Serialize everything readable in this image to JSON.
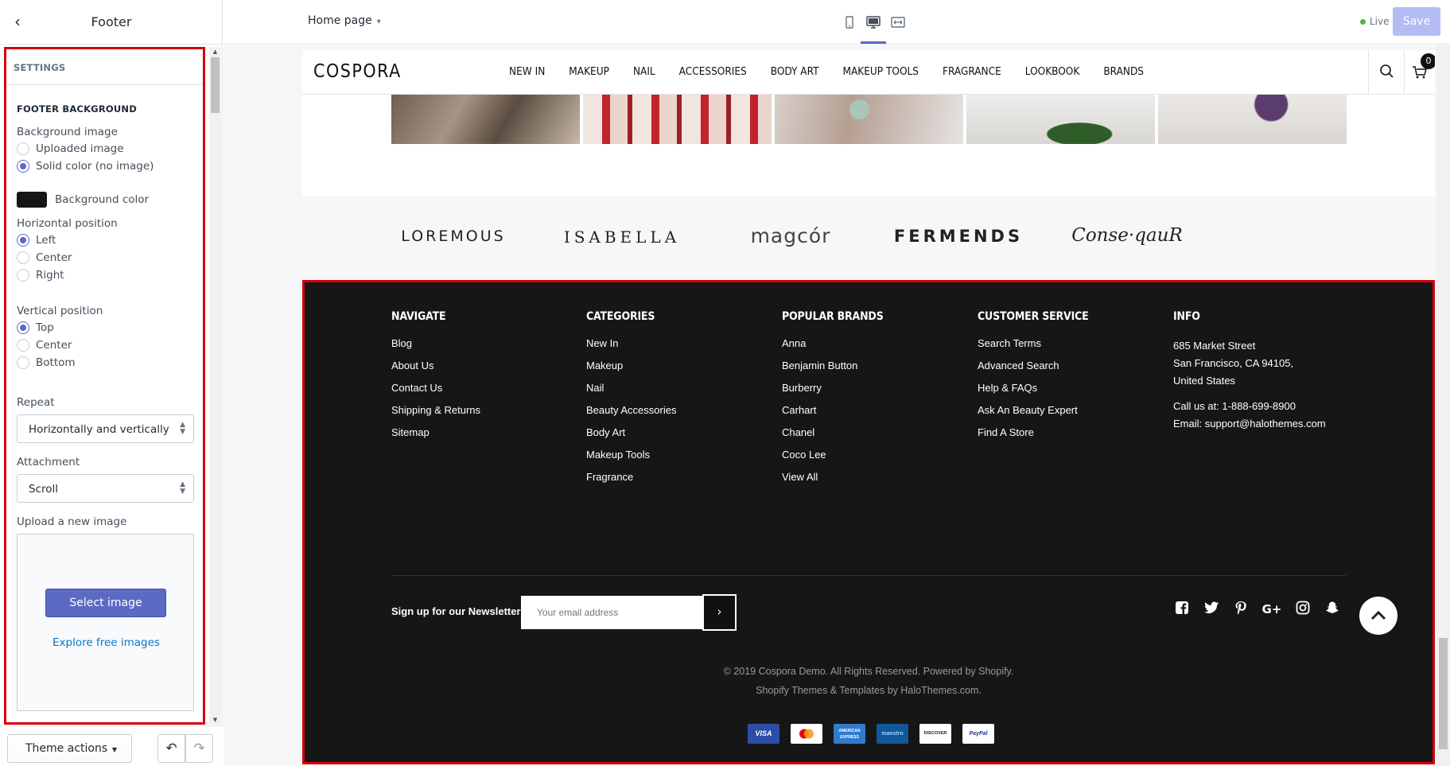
{
  "sidebar": {
    "title": "Footer",
    "section_label": "SETTINGS",
    "group_label": "FOOTER BACKGROUND",
    "background_image": {
      "label": "Background image",
      "options": [
        "Uploaded image",
        "Solid color (no image)"
      ],
      "selected": "Solid color (no image)"
    },
    "background_color": {
      "label": "Background color",
      "value": "#161616"
    },
    "horizontal_position": {
      "label": "Horizontal position",
      "options": [
        "Left",
        "Center",
        "Right"
      ],
      "selected": "Left"
    },
    "vertical_position": {
      "label": "Vertical position",
      "options": [
        "Top",
        "Center",
        "Bottom"
      ],
      "selected": "Top"
    },
    "repeat": {
      "label": "Repeat",
      "value": "Horizontally and vertically"
    },
    "attachment": {
      "label": "Attachment",
      "value": "Scroll"
    },
    "upload": {
      "label": "Upload a new image",
      "button": "Select image",
      "link": "Explore free images"
    },
    "theme_actions": "Theme actions"
  },
  "topbar": {
    "page": "Home page",
    "status": "Live",
    "save": "Save",
    "devices": [
      "mobile-icon",
      "desktop-icon",
      "fullscreen-icon"
    ],
    "selected_device": "desktop"
  },
  "store": {
    "logo": "COSPORA",
    "nav": [
      "NEW IN",
      "MAKEUP",
      "NAIL",
      "ACCESSORIES",
      "BODY ART",
      "MAKEUP TOOLS",
      "FRAGRANCE",
      "LOOKBOOK",
      "BRANDS"
    ],
    "cart_count": "0",
    "brands": [
      "LOREMOUS",
      "ISABELLA",
      "magcór",
      "FERMENDS",
      "Conse·qauR"
    ]
  },
  "footer": {
    "columns": [
      {
        "title": "NAVIGATE",
        "links": [
          "Blog",
          "About Us",
          "Contact Us",
          "Shipping & Returns",
          "Sitemap"
        ]
      },
      {
        "title": "CATEGORIES",
        "links": [
          "New In",
          "Makeup",
          "Nail",
          "Beauty Accessories",
          "Body Art",
          "Makeup Tools",
          "Fragrance"
        ]
      },
      {
        "title": "POPULAR BRANDS",
        "links": [
          "Anna",
          "Benjamin Button",
          "Burberry",
          "Carhart",
          "Chanel",
          "Coco Lee",
          "View All"
        ]
      },
      {
        "title": "CUSTOMER SERVICE",
        "links": [
          "Search Terms",
          "Advanced Search",
          "Help & FAQs",
          "Ask An Beauty Expert",
          "Find A Store"
        ]
      }
    ],
    "info": {
      "title": "INFO",
      "address": [
        "685 Market Street",
        "San Francisco, CA 94105,",
        "United States"
      ],
      "phone": "Call us at: 1-888-699-8900",
      "email": "Email: support@halothemes.com"
    },
    "newsletter": {
      "label": "Sign up for our Newsletter",
      "placeholder": "Your email address"
    },
    "social": [
      "facebook-icon",
      "twitter-icon",
      "pinterest-icon",
      "google-plus-icon",
      "instagram-icon",
      "snapchat-icon"
    ],
    "copyright": [
      "© 2019 Cospora Demo. All Rights Reserved. Powered by Shopify.",
      "Shopify Themes & Templates by HaloThemes.com."
    ],
    "payments": [
      "VISA",
      "mastercard",
      "AMERICAN EXPRESS",
      "maestro",
      "DISCOVER",
      "PayPal"
    ]
  },
  "colors": {
    "accent": "#5c6ac4",
    "highlight_outline": "#d4000b",
    "footer_bg": "#161616",
    "live": "#50b83c"
  }
}
